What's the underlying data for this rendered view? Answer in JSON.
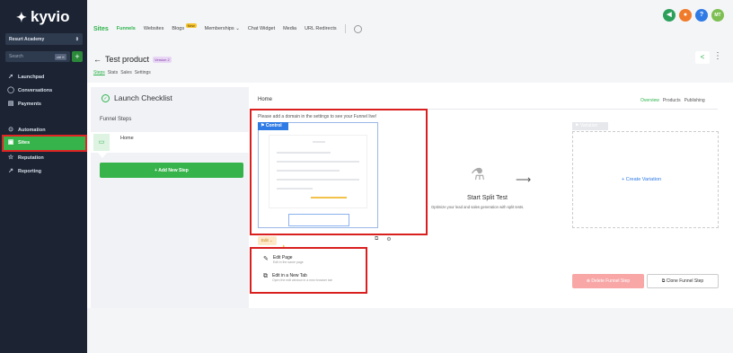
{
  "sidebar": {
    "logo": "kyvio",
    "account": "Resurt Academy",
    "search_placeholder": "Search",
    "search_shortcut": "ctrl K",
    "items": [
      {
        "label": "Launchpad",
        "icon": "rocket-icon"
      },
      {
        "label": "Conversations",
        "icon": "chat-icon"
      },
      {
        "label": "Payments",
        "icon": "card-icon"
      },
      {
        "label": "Automation",
        "icon": "automation-icon"
      },
      {
        "label": "Sites",
        "icon": "sites-icon"
      },
      {
        "label": "Reputation",
        "icon": "star-icon"
      },
      {
        "label": "Reporting",
        "icon": "chart-icon"
      }
    ],
    "active_color": "#36b34a"
  },
  "topnav": {
    "sites": "Sites",
    "funnels": "Funnels",
    "websites": "Websites",
    "blogs": "Blogs",
    "new_badge": "New",
    "memberships": "Memberships",
    "chat_widget": "Chat Widget",
    "media": "Media",
    "url_redirects": "URL Redirects"
  },
  "top_icons": [
    {
      "label": "",
      "color": "#2ca05a",
      "icon": "megaphone-icon"
    },
    {
      "label": "",
      "color": "#f07b2a",
      "icon": "bell-icon"
    },
    {
      "label": "?",
      "color": "#2f7be5",
      "icon": "help-icon"
    },
    {
      "label": "MT",
      "color": "#7dbf52",
      "icon": "avatar"
    }
  ],
  "header": {
    "title": "Test product",
    "version": "Version 2",
    "tabs": [
      "Steps",
      "Stats",
      "Sales",
      "Settings"
    ]
  },
  "checklist": {
    "title": "Launch Checklist",
    "funnel_steps_label": "Funnel Steps",
    "step_name": "Home",
    "add_step": "+ Add New Step"
  },
  "main": {
    "page_name": "Home",
    "tabs": [
      "Overview",
      "Products",
      "Publishing"
    ],
    "domain_note": "Please add a domain in the settings to see your Funnel live!",
    "control_tag": "Control",
    "variation_tag": "Variation",
    "edit_dropdown": "Edit",
    "split_title": "Start Split Test",
    "split_sub": "Optimize your lead and sales generation with split tests.",
    "create_variation": "+ Create Variation",
    "delete_step": "Delete Funnel Step",
    "clone_step": "Clone Funnel Step"
  },
  "edit_menu": [
    {
      "title": "Edit Page",
      "sub": "Edit in the same page",
      "icon": "pencil-icon"
    },
    {
      "title": "Edit in a New Tab",
      "sub": "Open the edit window in a new browser tab",
      "icon": "external-edit-icon"
    }
  ]
}
